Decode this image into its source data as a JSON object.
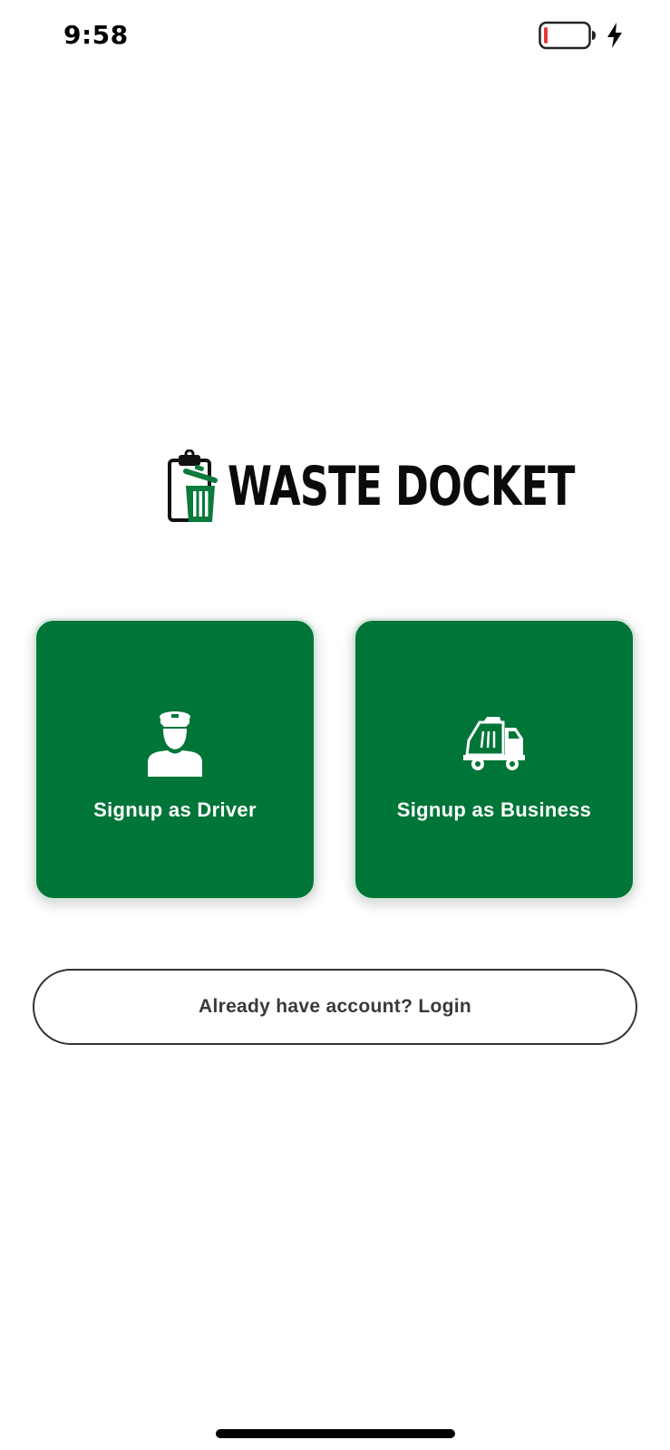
{
  "status_bar": {
    "time": "9:58"
  },
  "brand": {
    "name": "WASTE DOCKET",
    "primary_color": "#007538",
    "battery_low_color": "#e53935"
  },
  "signup_options": [
    {
      "label": "Signup as Driver",
      "icon": "driver-icon"
    },
    {
      "label": "Signup as Business",
      "icon": "garbage-truck-icon"
    }
  ],
  "login": {
    "label": "Already have account? Login"
  }
}
